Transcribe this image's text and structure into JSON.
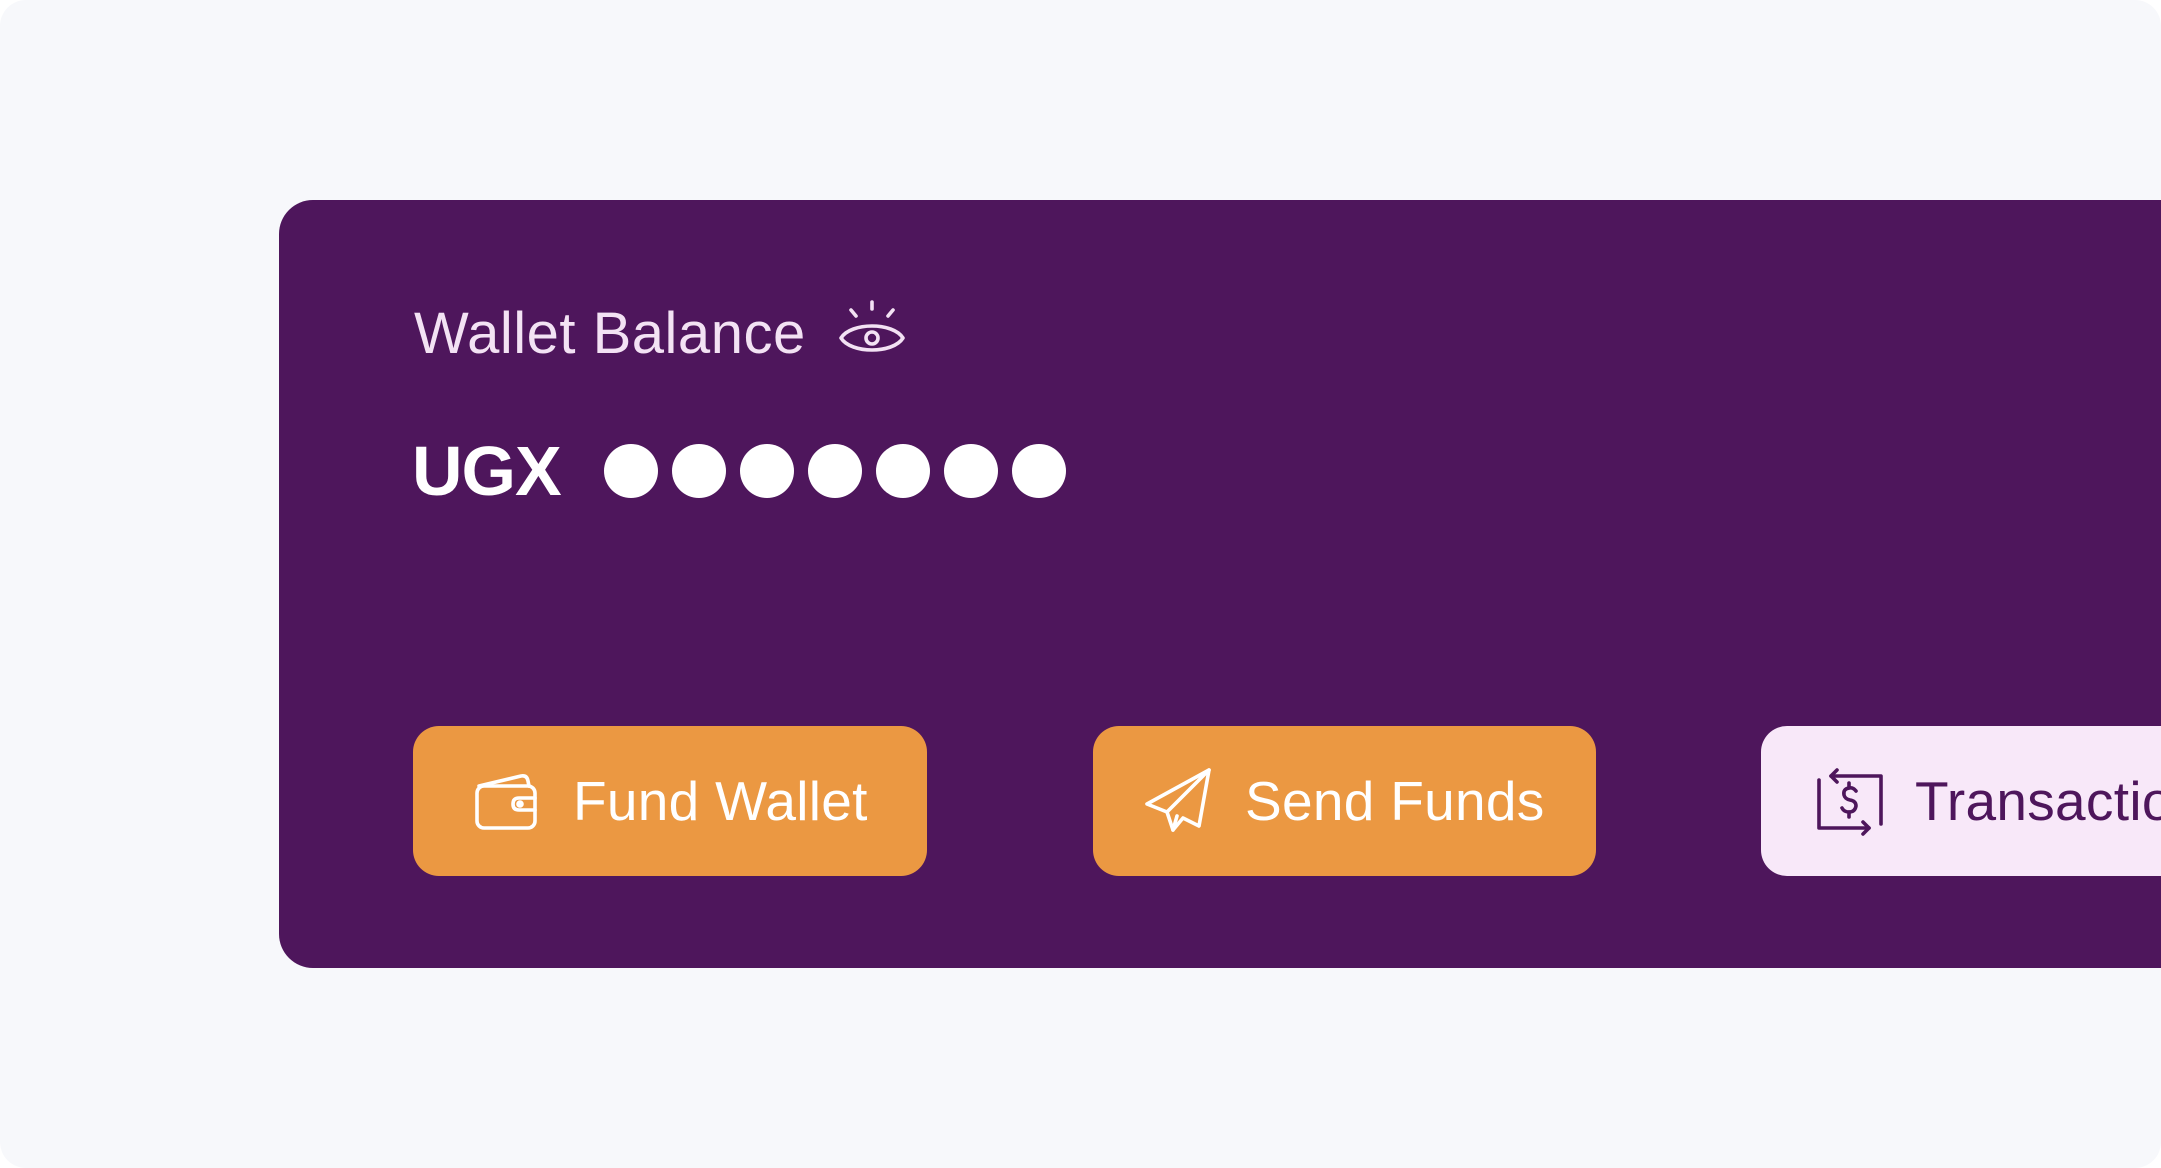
{
  "wallet": {
    "label": "Wallet Balance",
    "visibility_icon": "eye-icon",
    "currency": "UGX",
    "masked_digit_count": 7
  },
  "actions": {
    "fund": {
      "label": "Fund Wallet",
      "icon": "wallet-icon"
    },
    "send": {
      "label": "Send Funds",
      "icon": "paper-plane-icon"
    },
    "transactions": {
      "label": "Transactions",
      "icon": "transactions-exchange-icon"
    }
  },
  "colors": {
    "background": "#f7f8fb",
    "card": "#4e165c",
    "primary_button": "#eb9842",
    "secondary_button": "#f8e8f9",
    "text_light": "#ffffff"
  }
}
